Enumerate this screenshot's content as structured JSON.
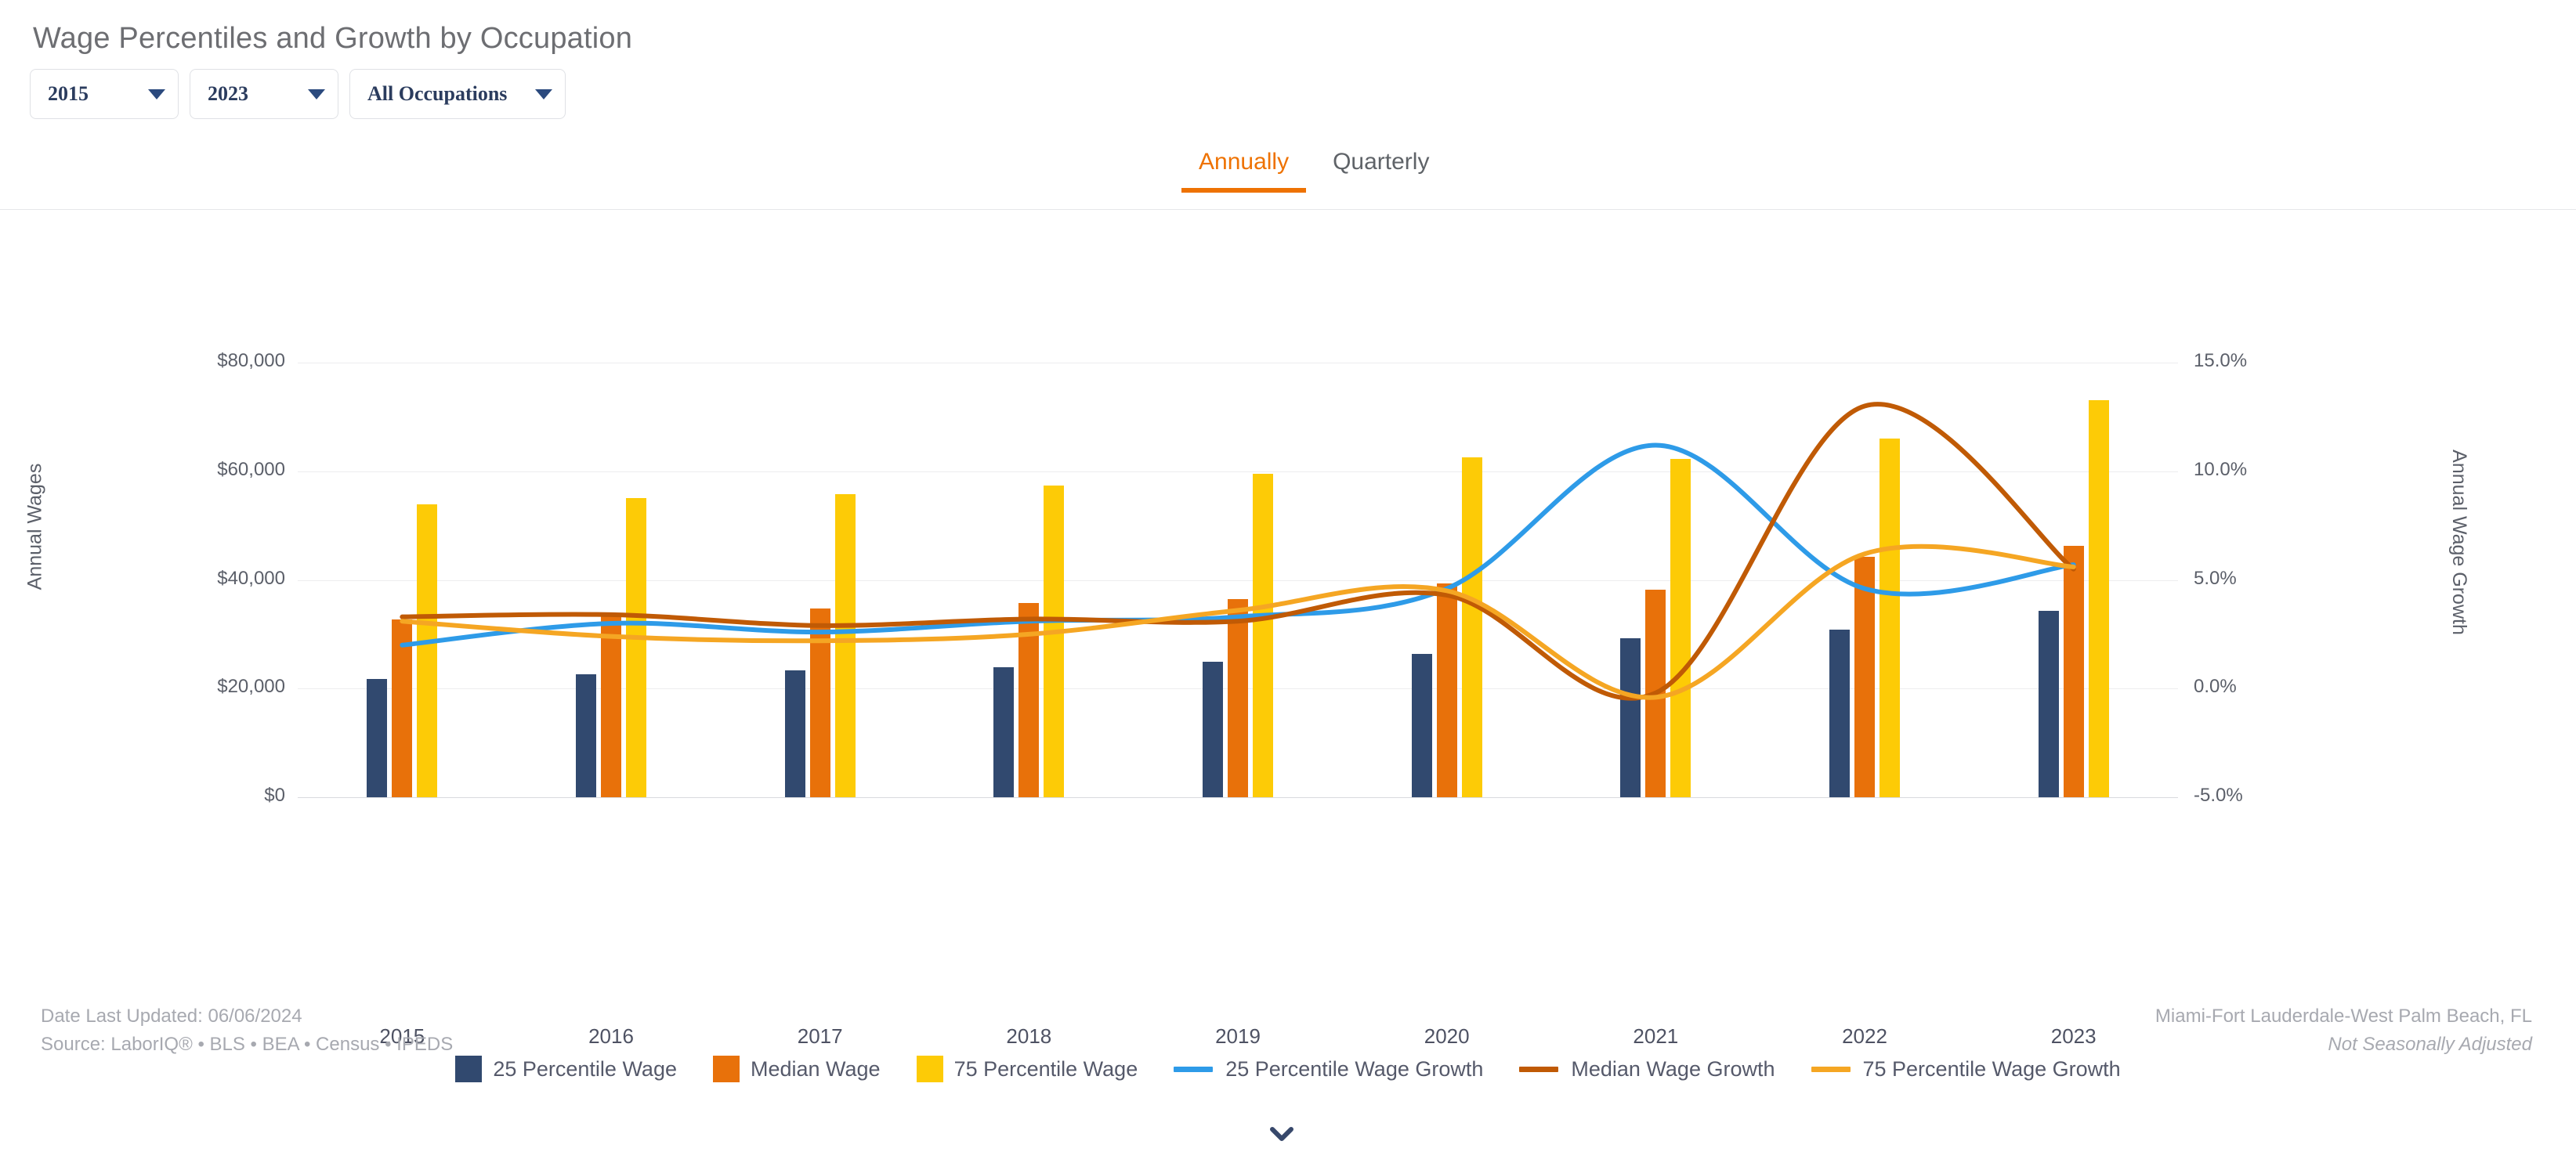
{
  "header": {
    "title": "Wage Percentiles and Growth by Occupation",
    "filters": [
      {
        "name": "start-year",
        "value": "2015"
      },
      {
        "name": "end-year",
        "value": "2023"
      },
      {
        "name": "occupation",
        "value": "All Occupations"
      }
    ]
  },
  "tabs": [
    {
      "label": "Annually",
      "active": true
    },
    {
      "label": "Quarterly",
      "active": false
    }
  ],
  "footer": {
    "date_last_updated": "Date Last Updated: 06/06/2024",
    "source": "Source: LaborIQ® • BLS • BEA • Census • IPEDS",
    "region": "Miami-Fort Lauderdale-West Palm Beach, FL",
    "adjustment": "Not Seasonally Adjusted"
  },
  "icons": {
    "caret": "chevron-down-icon",
    "expand": "chevron-down-icon"
  },
  "colors": {
    "p25_wage": "#31496f",
    "median_wage": "#e8710a",
    "p75_wage": "#fdcb06",
    "p25_growth": "#2e9be8",
    "median_growth": "#c05a05",
    "p75_growth": "#f5a623",
    "accent": "#ee7202",
    "grid": "#ededef",
    "text": "#5b5f69"
  },
  "chart_data": {
    "type": "bar",
    "title": "Wage Percentiles and Growth by Occupation",
    "xlabel": "",
    "ylabel": "Annual Wages",
    "y2label": "Annual Wage Growth",
    "categories": [
      "2015",
      "2016",
      "2017",
      "2018",
      "2019",
      "2020",
      "2021",
      "2022",
      "2023"
    ],
    "ylim": [
      0,
      80000
    ],
    "yticks": [
      0,
      20000,
      40000,
      60000,
      80000
    ],
    "ytick_labels": [
      "$0",
      "$20,000",
      "$40,000",
      "$60,000",
      "$80,000"
    ],
    "y2lim": [
      -5,
      15
    ],
    "y2ticks": [
      -5,
      0,
      5,
      10,
      15
    ],
    "y2tick_labels": [
      "-5.0%",
      "0.0%",
      "5.0%",
      "10.0%",
      "15.0%"
    ],
    "grid": true,
    "legend_position": "bottom",
    "bar_series": [
      {
        "name": "25 Percentile Wage",
        "color": "#31496f",
        "values": [
          21800,
          22700,
          23300,
          23900,
          25000,
          26400,
          29300,
          30800,
          34300
        ]
      },
      {
        "name": "Median Wage",
        "color": "#e8710a",
        "values": [
          32700,
          33400,
          34800,
          35700,
          36500,
          39300,
          38200,
          44200,
          46300
        ]
      },
      {
        "name": "75 Percentile Wage",
        "color": "#fdcb06",
        "values": [
          53900,
          55000,
          55800,
          57400,
          59500,
          62500,
          62300,
          66000,
          73100
        ]
      }
    ],
    "line_series": [
      {
        "name": "25 Percentile Wage Growth",
        "color": "#2e9be8",
        "values": [
          2.0,
          3.0,
          2.6,
          3.1,
          3.3,
          4.6,
          11.2,
          4.6,
          5.7
        ]
      },
      {
        "name": "Median Wage Growth",
        "color": "#c05a05",
        "values": [
          3.3,
          3.4,
          2.9,
          3.2,
          3.1,
          4.3,
          -0.2,
          13.0,
          5.5
        ]
      },
      {
        "name": "75 Percentile Wage Growth",
        "color": "#f5a623",
        "values": [
          3.1,
          2.4,
          2.2,
          2.5,
          3.6,
          4.5,
          -0.4,
          6.2,
          5.6
        ]
      }
    ]
  },
  "legend": [
    {
      "label": "25 Percentile Wage",
      "type": "bar",
      "color": "#31496f"
    },
    {
      "label": "Median Wage",
      "type": "bar",
      "color": "#e8710a"
    },
    {
      "label": "75 Percentile Wage",
      "type": "bar",
      "color": "#fdcb06"
    },
    {
      "label": "25 Percentile Wage Growth",
      "type": "line",
      "color": "#2e9be8"
    },
    {
      "label": "Median Wage Growth",
      "type": "line",
      "color": "#c05a05"
    },
    {
      "label": "75 Percentile Wage Growth",
      "type": "line",
      "color": "#f5a623"
    }
  ]
}
